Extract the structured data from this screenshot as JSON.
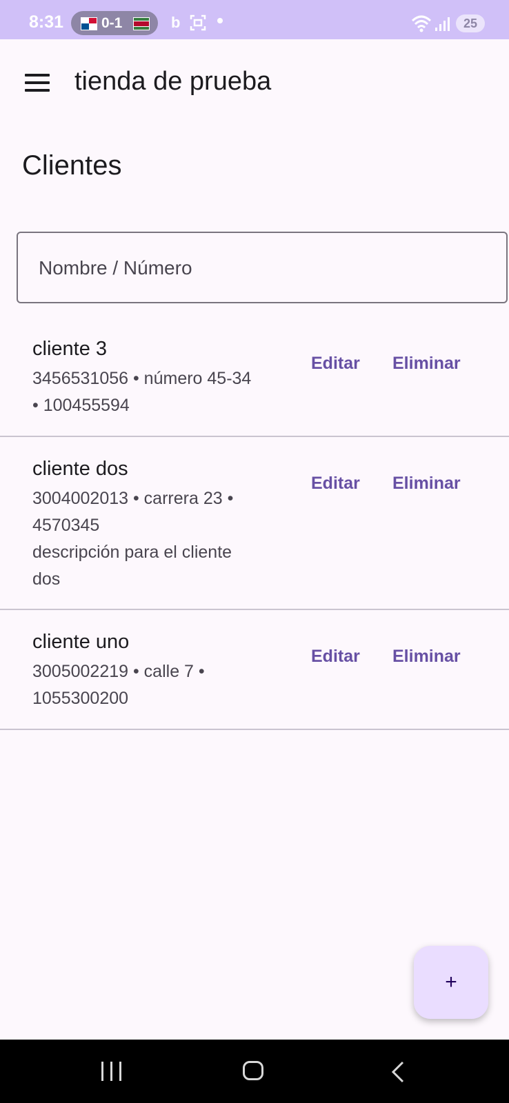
{
  "status_bar": {
    "time": "8:31",
    "score": "0-1",
    "battery": "25",
    "icons": [
      "flag-panama-icon",
      "flag-suriname-icon",
      "bing-icon",
      "screenshot-icon",
      "notification-dot-icon",
      "wifi-icon",
      "signal-icon",
      "battery-icon"
    ]
  },
  "app_bar": {
    "title": "tienda de prueba",
    "menu_icon": "menu-icon"
  },
  "page": {
    "title": "Clientes"
  },
  "search": {
    "placeholder": "Nombre / Número",
    "value": ""
  },
  "clients": [
    {
      "name": "cliente 3",
      "detail_line1": "3456531056 • número 45-34",
      "detail_line2": "• 100455594",
      "description_line1": "",
      "description_line2": "",
      "edit_label": "Editar",
      "delete_label": "Eliminar"
    },
    {
      "name": "cliente dos",
      "detail_line1": "3004002013 • carrera 23 •",
      "detail_line2": "4570345",
      "description_line1": "descripción para el cliente",
      "description_line2": "dos",
      "edit_label": "Editar",
      "delete_label": "Eliminar"
    },
    {
      "name": "cliente uno",
      "detail_line1": "3005002219 • calle 7 •",
      "detail_line2": "1055300200",
      "description_line1": "",
      "description_line2": "",
      "edit_label": "Editar",
      "delete_label": "Eliminar"
    }
  ],
  "fab": {
    "label": "+"
  },
  "nav_bar": {
    "icons": [
      "recent-apps-icon",
      "home-icon",
      "back-icon"
    ]
  },
  "colors": {
    "status_bar_bg": "#d0c0f8",
    "background": "#fdf8fd",
    "accent": "#6750a4",
    "fab_bg": "#eaddff"
  }
}
